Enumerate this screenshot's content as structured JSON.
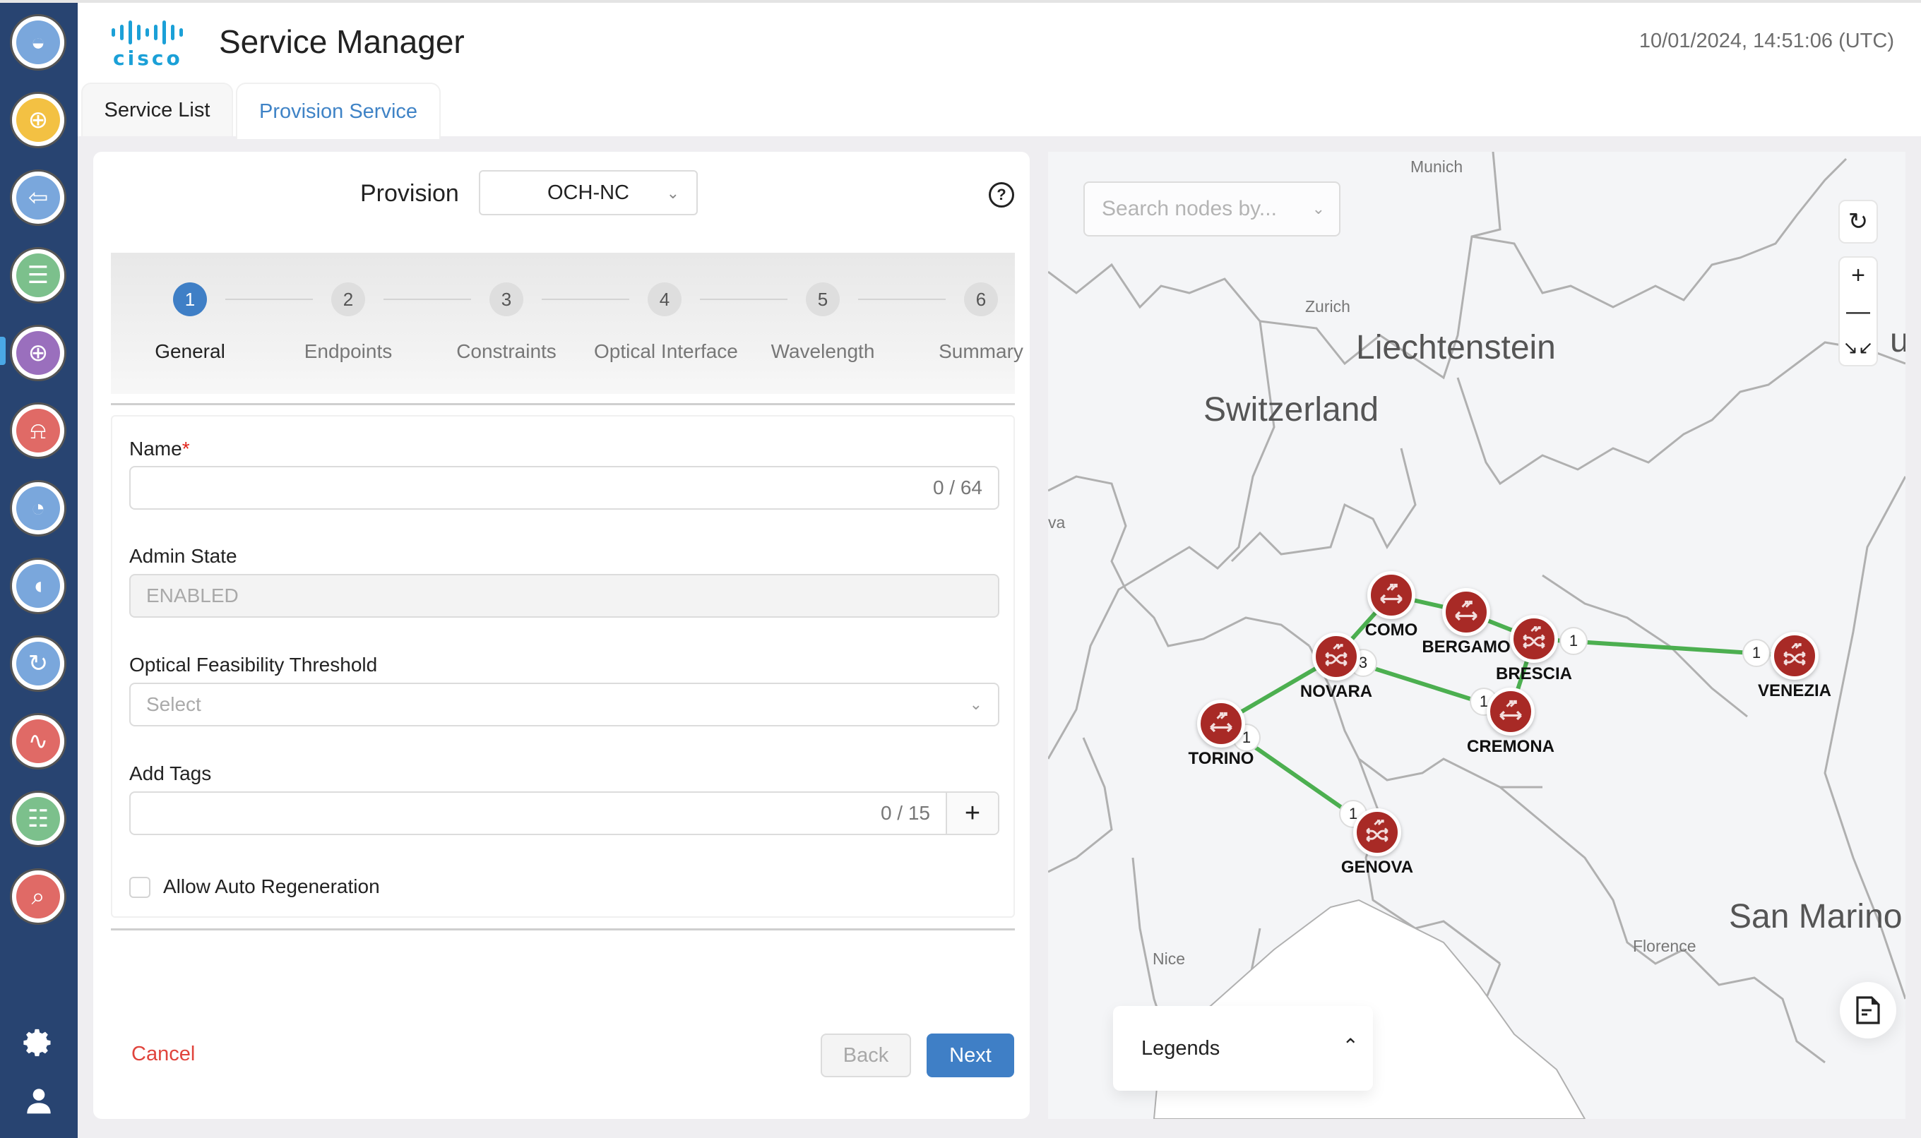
{
  "header": {
    "logo_text": "cisco",
    "title": "Service Manager",
    "datetime": "10/01/2024, 14:51:06 (UTC)"
  },
  "sidebar": {
    "items": [
      {
        "name": "topology",
        "icon": "globe-network-icon",
        "color": "#7aa7dc"
      },
      {
        "name": "inventory",
        "icon": "database-add-icon",
        "color": "#f3c143"
      },
      {
        "name": "import",
        "icon": "import-arrow-icon",
        "color": "#7aa7dc"
      },
      {
        "name": "documents",
        "icon": "documents-icon",
        "color": "#7cc08c"
      },
      {
        "name": "service-manager",
        "icon": "service-add-icon",
        "color": "#9a6fbd",
        "active": true
      },
      {
        "name": "alarms",
        "icon": "bell-icon",
        "color": "#e06a66"
      },
      {
        "name": "dashboard",
        "icon": "pie-chart-icon",
        "color": "#7aa7dc"
      },
      {
        "name": "circuit",
        "icon": "network-path-icon",
        "color": "#7aa7dc"
      },
      {
        "name": "sync",
        "icon": "sync-disk-icon",
        "color": "#7aa7dc"
      },
      {
        "name": "performance",
        "icon": "performance-chart-icon",
        "color": "#e06a66"
      },
      {
        "name": "scheduled-reports",
        "icon": "scheduled-report-icon",
        "color": "#7cc08c"
      },
      {
        "name": "diagnostics",
        "icon": "diagnostics-search-icon",
        "color": "#e06a66"
      }
    ],
    "settings_icon": "gear-icon",
    "user_icon": "user-icon"
  },
  "tabs": [
    {
      "label": "Service List",
      "active": false
    },
    {
      "label": "Provision Service",
      "active": true
    }
  ],
  "provision": {
    "label": "Provision",
    "selected": "OCH-NC"
  },
  "steps": [
    {
      "num": "1",
      "label": "General",
      "active": true
    },
    {
      "num": "2",
      "label": "Endpoints",
      "active": false
    },
    {
      "num": "3",
      "label": "Constraints",
      "active": false
    },
    {
      "num": "4",
      "label": "Optical Interface",
      "active": false
    },
    {
      "num": "5",
      "label": "Wavelength",
      "active": false
    },
    {
      "num": "6",
      "label": "Summary",
      "active": false
    }
  ],
  "form": {
    "name_label": "Name",
    "name_required": "*",
    "name_value": "",
    "name_count": "0 / 64",
    "admin_state_label": "Admin State",
    "admin_state_value": "ENABLED",
    "oft_label": "Optical Feasibility Threshold",
    "oft_placeholder": "Select",
    "tags_label": "Add Tags",
    "tags_value": "",
    "tags_count": "0 / 15",
    "auto_regen_label": "Allow Auto Regeneration",
    "auto_regen_checked": false
  },
  "buttons": {
    "cancel": "Cancel",
    "back": "Back",
    "next": "Next"
  },
  "map": {
    "search_placeholder": "Search nodes by...",
    "legend_label": "Legends",
    "labels": [
      {
        "text": "Munich",
        "type": "city"
      },
      {
        "text": "Zurich",
        "type": "city"
      },
      {
        "text": "Liechtenstein",
        "type": "country"
      },
      {
        "text": "Switzerland",
        "type": "country"
      },
      {
        "text": "us",
        "type": "country"
      },
      {
        "text": "va",
        "type": "city"
      },
      {
        "text": "Nice",
        "type": "city"
      },
      {
        "text": "Florence",
        "type": "city"
      },
      {
        "text": "San Marino",
        "type": "country"
      }
    ],
    "nodes": [
      {
        "name": "COMO",
        "type": "roadm-line"
      },
      {
        "name": "BERGAMO",
        "type": "roadm-line"
      },
      {
        "name": "BRESCIA",
        "type": "roadm-cross"
      },
      {
        "name": "NOVARA",
        "type": "roadm-cross"
      },
      {
        "name": "CREMONA",
        "type": "roadm-line"
      },
      {
        "name": "TORINO",
        "type": "roadm-line"
      },
      {
        "name": "GENOVA",
        "type": "roadm-cross"
      },
      {
        "name": "VENEZIA",
        "type": "roadm-cross"
      }
    ],
    "links": [
      {
        "from": "NOVARA",
        "to": "COMO"
      },
      {
        "from": "COMO",
        "to": "BERGAMO"
      },
      {
        "from": "BERGAMO",
        "to": "BRESCIA"
      },
      {
        "from": "BRESCIA",
        "to": "VENEZIA"
      },
      {
        "from": "BRESCIA",
        "to": "CREMONA"
      },
      {
        "from": "NOVARA",
        "to": "CREMONA"
      },
      {
        "from": "TORINO",
        "to": "NOVARA"
      },
      {
        "from": "TORINO",
        "to": "GENOVA"
      }
    ],
    "port_badges": [
      {
        "node": "BRESCIA",
        "count": "1"
      },
      {
        "node": "VENEZIA",
        "count": "1"
      },
      {
        "node": "NOVARA",
        "count": "3"
      },
      {
        "node": "CREMONA",
        "count": "1"
      },
      {
        "node": "TORINO",
        "count": "1"
      },
      {
        "node": "GENOVA",
        "count": "1"
      }
    ],
    "link_color": "#4caf50",
    "node_color": "#a82a26"
  }
}
